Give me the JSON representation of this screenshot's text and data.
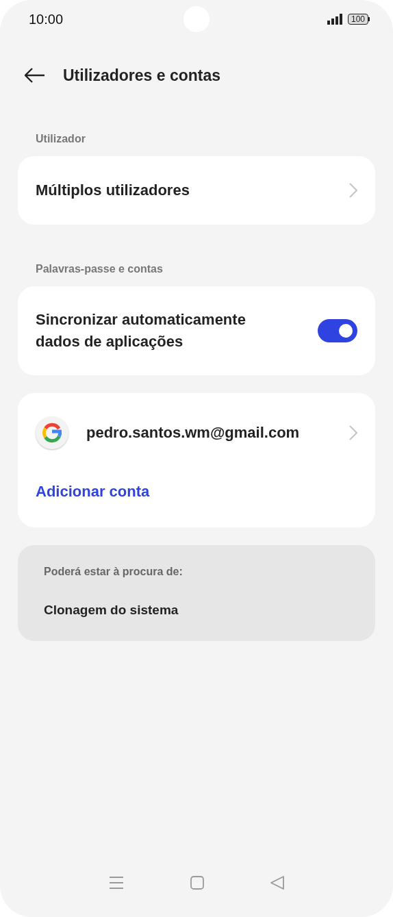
{
  "status_bar": {
    "time": "10:00",
    "battery": "100"
  },
  "header": {
    "title": "Utilizadores e contas"
  },
  "sections": [
    {
      "label": "Utilizador",
      "cards": [
        {
          "items": [
            {
              "kind": "link",
              "label": "Múltiplos utilizadores"
            }
          ]
        }
      ]
    },
    {
      "label": "Palavras-passe e contas",
      "cards": [
        {
          "items": [
            {
              "kind": "toggle",
              "label": "Sincronizar automaticamente dados de aplicações",
              "on": true
            }
          ]
        },
        {
          "items": [
            {
              "kind": "account",
              "label": "pedro.santos.wm@gmail.com"
            },
            {
              "kind": "action",
              "label": "Adicionar conta"
            }
          ]
        }
      ]
    }
  ],
  "suggestions": {
    "title": "Poderá estar à procura de:",
    "items": [
      "Clonagem do sistema"
    ]
  }
}
